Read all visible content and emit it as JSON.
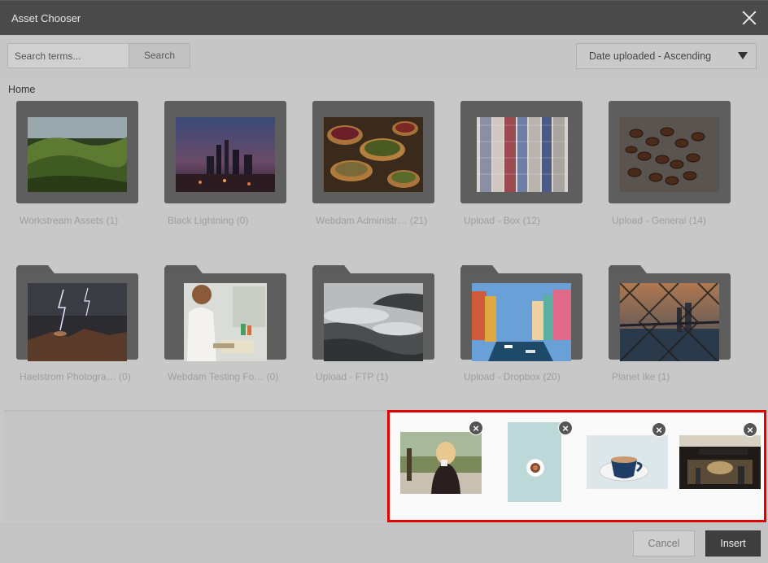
{
  "window": {
    "title": "Asset Chooser"
  },
  "toolbar": {
    "search_placeholder": "Search terms...",
    "search_label": "Search",
    "sort_selected": "Date uploaded - Ascending"
  },
  "breadcrumb": {
    "home": "Home"
  },
  "folders": [
    {
      "label": "Workstream Assets (1)",
      "image": "green-hills"
    },
    {
      "label": "Black Lightning (0)",
      "image": "night-city"
    },
    {
      "label": "Webdam Administr… (21)",
      "image": "spices"
    },
    {
      "label": "Upload - Box (12)",
      "image": "shirts"
    },
    {
      "label": "Upload - General (14)",
      "image": "coffee-beans"
    },
    {
      "label": "Haelstrom Photogra… (0)",
      "image": "lightning-canyon"
    },
    {
      "label": "Webdam Testing Fo… (0)",
      "image": "office-woman"
    },
    {
      "label": "Upload - FTP (1)",
      "image": "misty-forest"
    },
    {
      "label": "Upload - Dropbox (20)",
      "image": "canal-houses"
    },
    {
      "label": "Planet Ike (1)",
      "image": "bridge-fence"
    }
  ],
  "selected_assets": [
    {
      "name": "woman-drinking-coffee"
    },
    {
      "name": "espresso-cup-top-view"
    },
    {
      "name": "blue-coffee-cup"
    },
    {
      "name": "cafe-storefront"
    }
  ],
  "footer": {
    "cancel_label": "Cancel",
    "insert_label": "Insert"
  },
  "colors": {
    "selection_border": "#e00000",
    "titlebar": "#4a4a4a"
  }
}
